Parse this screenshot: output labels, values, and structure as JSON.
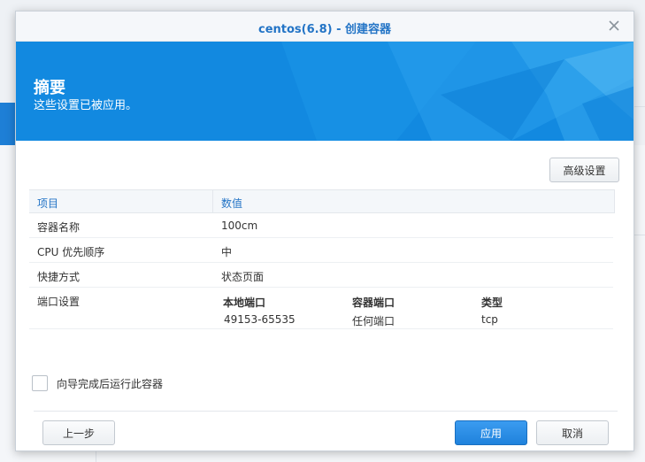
{
  "window": {
    "title": "centos(6.8) - 创建容器"
  },
  "banner": {
    "title": "摘要",
    "subtitle": "这些设置已被应用。"
  },
  "toolbar": {
    "advanced_label": "高级设置"
  },
  "table": {
    "headers": [
      "项目",
      "数值"
    ],
    "rows": [
      {
        "key": "容器名称",
        "value": "100cm"
      },
      {
        "key": "CPU 优先顺序",
        "value": "中"
      },
      {
        "key": "快捷方式",
        "value": "状态页面"
      }
    ],
    "port_row": {
      "key": "端口设置",
      "headers": [
        "本地端口",
        "容器端口",
        "类型"
      ],
      "values": [
        "49153-65535",
        "任何端口",
        "tcp"
      ]
    }
  },
  "options": {
    "run_after_label": "向导完成后运行此容器",
    "run_after_checked": false
  },
  "footer": {
    "prev_label": "上一步",
    "apply_label": "应用",
    "cancel_label": "取消"
  },
  "colors": {
    "accent": "#2374c6",
    "banner": "#1289e0",
    "primary_button": "#1f82dc"
  }
}
